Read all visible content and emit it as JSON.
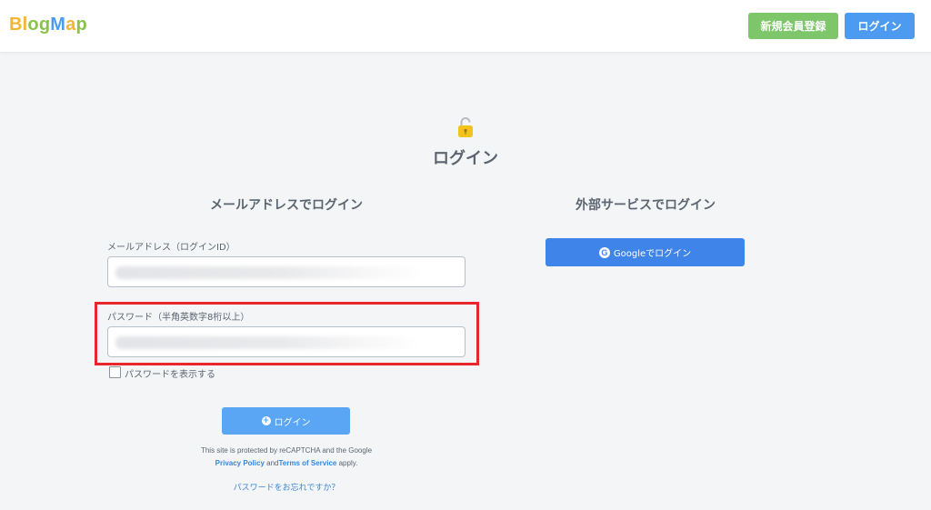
{
  "header": {
    "logo_letters": [
      {
        "ch": "B",
        "color": "#f2b632"
      },
      {
        "ch": "l",
        "color": "#f2b632"
      },
      {
        "ch": "o",
        "color": "#8bc34a"
      },
      {
        "ch": "g",
        "color": "#8bc34a"
      },
      {
        "ch": "M",
        "color": "#4d9bf0"
      },
      {
        "ch": "a",
        "color": "#f2b632"
      },
      {
        "ch": "p",
        "color": "#8bc34a"
      }
    ],
    "register_label": "新規会員登録",
    "login_label": "ログイン"
  },
  "main": {
    "title": "ログイン",
    "email_section": {
      "title": "メールアドレスでログイン",
      "email_label": "メールアドレス（ログインID）",
      "email_value": "",
      "password_label": "パスワード（半角英数字8桁以上）",
      "password_value": "",
      "show_password_label": "パスワードを表示する",
      "show_password_checked": false,
      "submit_label": "ログイン",
      "recaptcha_prefix": "This site is protected by reCAPTCHA and the Google",
      "privacy_label": "Privacy Policy",
      "and_text": " and",
      "terms_label": "Terms of Service",
      "apply_text": " apply.",
      "forgot_label": "パスワードをお忘れですか？"
    },
    "external_section": {
      "title": "外部サービスでログイン",
      "google_label": "Googleでログイン"
    }
  },
  "colors": {
    "register_green": "#7dc66a",
    "login_blue": "#4d9bf0",
    "google_blue": "#3f84e8",
    "highlight_red": "#e8262b",
    "link_blue": "#3a86d8"
  }
}
